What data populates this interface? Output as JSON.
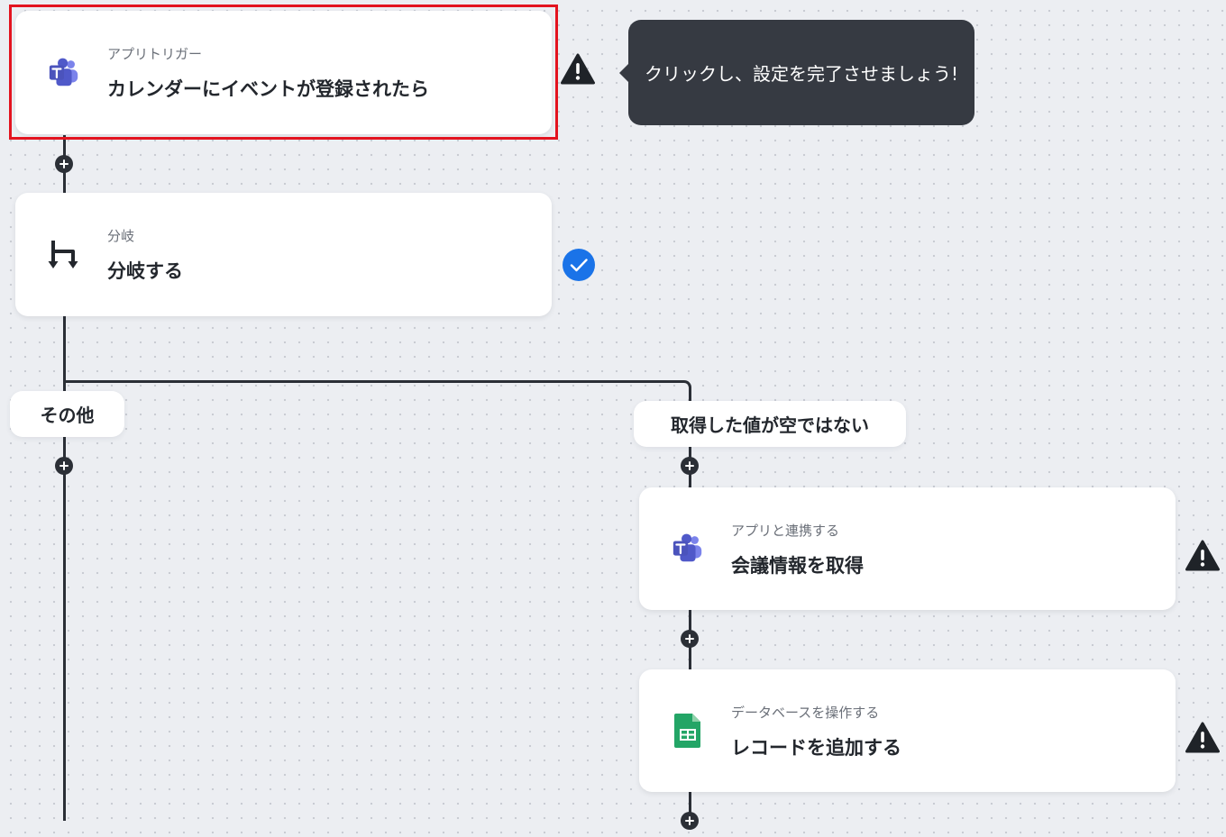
{
  "flow": {
    "trigger": {
      "category": "アプリトリガー",
      "title": "カレンダーにイベントが登録されたら",
      "app_icon": "microsoft-teams-icon",
      "status": "warning"
    },
    "tooltip": {
      "text": "クリックし、設定を完了させましょう!"
    },
    "branch": {
      "category": "分岐",
      "title": "分岐する",
      "icon": "branch-icon",
      "status": "complete"
    },
    "branches": {
      "left_label": "その他",
      "right_label": "取得した値が空ではない"
    },
    "steps": [
      {
        "category": "アプリと連携する",
        "title": "会議情報を取得",
        "app_icon": "microsoft-teams-icon",
        "status": "warning"
      },
      {
        "category": "データベースを操作する",
        "title": "レコードを追加する",
        "app_icon": "google-sheets-icon",
        "status": "warning"
      }
    ]
  },
  "colors": {
    "canvas_background": "#eceef2",
    "connector": "#2b2f36",
    "selected_outline": "#e3131f",
    "tooltip_background": "#363a42",
    "complete_badge": "#1a73e8",
    "teams_purple": "#5059c9",
    "sheets_green": "#23a566"
  }
}
